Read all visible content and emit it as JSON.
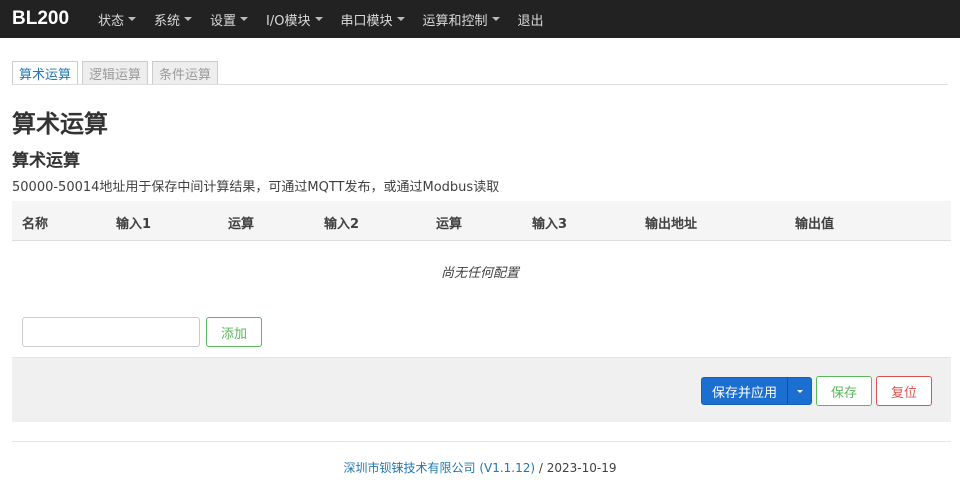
{
  "navbar": {
    "brand": "BL200",
    "items": [
      {
        "label": "状态",
        "caret": true
      },
      {
        "label": "系统",
        "caret": true
      },
      {
        "label": "设置",
        "caret": true
      },
      {
        "label": "I/O模块",
        "caret": true
      },
      {
        "label": "串口模块",
        "caret": true
      },
      {
        "label": "运算和控制",
        "caret": true
      },
      {
        "label": "退出",
        "caret": false
      }
    ]
  },
  "tabs": [
    {
      "label": "算术运算",
      "active": true
    },
    {
      "label": "逻辑运算",
      "active": false
    },
    {
      "label": "条件运算",
      "active": false
    }
  ],
  "page": {
    "title": "算术运算",
    "section_title": "算术运算",
    "description": "50000-50014地址用于保存中间计算结果，可通过MQTT发布，或通过Modbus读取"
  },
  "table": {
    "columns": [
      "名称",
      "输入1",
      "运算",
      "输入2",
      "运算",
      "输入3",
      "输出地址",
      "输出值"
    ],
    "empty_text": "尚无任何配置"
  },
  "add": {
    "input_value": "",
    "button_label": "添加"
  },
  "actions": {
    "save_apply_label": "保存并应用",
    "save_label": "保存",
    "reset_label": "复位"
  },
  "footer": {
    "company": "深圳市钡铼技术有限公司 (V1.1.12)",
    "date": " / 2023-10-19"
  }
}
